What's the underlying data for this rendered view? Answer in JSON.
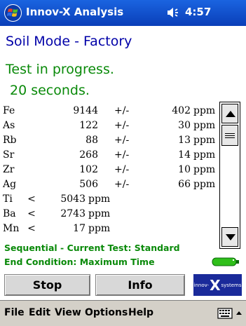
{
  "titlebar": {
    "app_title": "Innov-X Analysis",
    "time": "4:57",
    "icons": [
      "windows-flag-icon",
      "speaker-icon"
    ]
  },
  "header": {
    "mode_title": "Soil Mode - Factory",
    "status": "Test in progress.",
    "elapsed": "20 seconds."
  },
  "results": {
    "measured": [
      {
        "element": "Fe",
        "value": "9144",
        "pm": "+/-",
        "error": "402",
        "unit": "ppm"
      },
      {
        "element": "As",
        "value": "122",
        "pm": "+/-",
        "error": "30",
        "unit": "ppm"
      },
      {
        "element": "Rb",
        "value": "88",
        "pm": "+/-",
        "error": "13",
        "unit": "ppm"
      },
      {
        "element": "Sr",
        "value": "268",
        "pm": "+/-",
        "error": "14",
        "unit": "ppm"
      },
      {
        "element": "Zr",
        "value": "102",
        "pm": "+/-",
        "error": "10",
        "unit": "ppm"
      },
      {
        "element": "Ag",
        "value": "506",
        "pm": "+/-",
        "error": "66",
        "unit": "ppm"
      }
    ],
    "below_limit": [
      {
        "element": "Ti",
        "op": "<",
        "value": "5043",
        "unit": "ppm"
      },
      {
        "element": "Ba",
        "op": "<",
        "value": "2743",
        "unit": "ppm"
      },
      {
        "element": "Mn",
        "op": "<",
        "value": "17",
        "unit": "ppm"
      }
    ]
  },
  "footer_info": {
    "sequence": "Sequential - Current Test: Standard",
    "end_condition": "End Condition: Maximum Time"
  },
  "buttons": {
    "stop": "Stop",
    "info": "Info"
  },
  "logo": {
    "left": "innov-",
    "x": "X",
    "right": "systems"
  },
  "menu": {
    "items": [
      "File",
      "Edit",
      "View",
      "Options",
      "Help"
    ]
  },
  "colors": {
    "title_bar": "#0a3fb8",
    "mode_title": "#0000a8",
    "status_green": "#0a8a0a",
    "menu_bg": "#d4d0c8"
  }
}
